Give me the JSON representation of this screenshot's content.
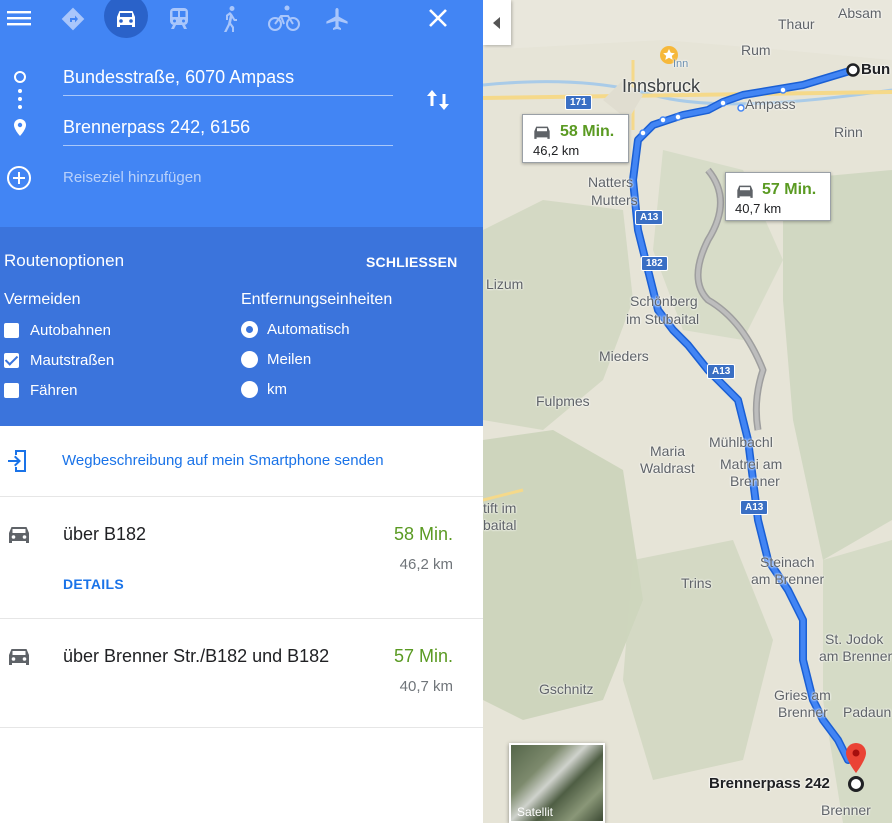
{
  "modes": {
    "menu": "menu-icon",
    "items": [
      {
        "name": "directions-icon",
        "active": false
      },
      {
        "name": "car-icon",
        "active": true
      },
      {
        "name": "train-icon",
        "active": false
      },
      {
        "name": "walk-icon",
        "active": false
      },
      {
        "name": "bike-icon",
        "active": false
      },
      {
        "name": "flight-icon",
        "active": false
      }
    ],
    "close": "close-icon"
  },
  "directions": {
    "origin": "Bundesstraße, 6070 Ampass",
    "destination": "Brennerpass 242, 6156",
    "add_destination_placeholder": "Reiseziel hinzufügen"
  },
  "options": {
    "title": "Routenoptionen",
    "close_label": "SCHLIESSEN",
    "avoid_heading": "Vermeiden",
    "avoid": [
      {
        "label": "Autobahnen",
        "checked": false
      },
      {
        "label": "Mautstraßen",
        "checked": true
      },
      {
        "label": "Fähren",
        "checked": false
      }
    ],
    "units_heading": "Entfernungseinheiten",
    "units": [
      {
        "label": "Automatisch",
        "checked": true
      },
      {
        "label": "Meilen",
        "checked": false
      },
      {
        "label": "km",
        "checked": false
      }
    ]
  },
  "send_to_phone": "Wegbeschreibung auf mein Smartphone senden",
  "routes": [
    {
      "name": "über B182",
      "time": "58 Min.",
      "distance": "46,2 km",
      "details": "DETAILS"
    },
    {
      "name": "über Brenner Str./B182 und B182",
      "time": "57 Min.",
      "distance": "40,7 km"
    }
  ],
  "map": {
    "places": {
      "absam": "Absam",
      "thaur": "Thaur",
      "rum": "Rum",
      "innsbruck": "Innsbruck",
      "bun": "Bun",
      "ampass": "Ampass",
      "rinn": "Rinn",
      "natters": "Natters",
      "mutters": "Mutters",
      "lizum": "Lizum",
      "schoenberg": "Schönberg",
      "stubaital": "im Stubaital",
      "mieders": "Mieders",
      "fulpmes": "Fulpmes",
      "muehlbachl": "Mühlbachl",
      "matrei1": "Matrei am",
      "matrei2": "Brenner",
      "maria": "Maria",
      "waldrast": "Waldrast",
      "stift1": "tift im",
      "stift2": "baital",
      "steinach1": "Steinach",
      "steinach2": "am Brenner",
      "trins": "Trins",
      "jodok1": "St. Jodok",
      "jodok2": "am Brenner",
      "gschnitz": "Gschnitz",
      "gries1": "Gries am",
      "gries2": "Brenner",
      "padaun": "Padaun",
      "brennerpass": "Brennerpass 242",
      "brenner": "Brenner",
      "inn": "Inn"
    },
    "shields": {
      "s171": "171",
      "a13a": "A13",
      "b182": "182",
      "a13b": "A13",
      "a13c": "A13"
    },
    "callout_primary": {
      "time": "58 Min.",
      "distance": "46,2 km"
    },
    "callout_alt": {
      "time": "57 Min.",
      "distance": "40,7 km"
    },
    "satellite_label": "Satellit",
    "colors": {
      "route": "#4285f4",
      "alt_route": "#a8a8a8",
      "panel": "#4285f4",
      "time": "#5a9a22"
    }
  }
}
